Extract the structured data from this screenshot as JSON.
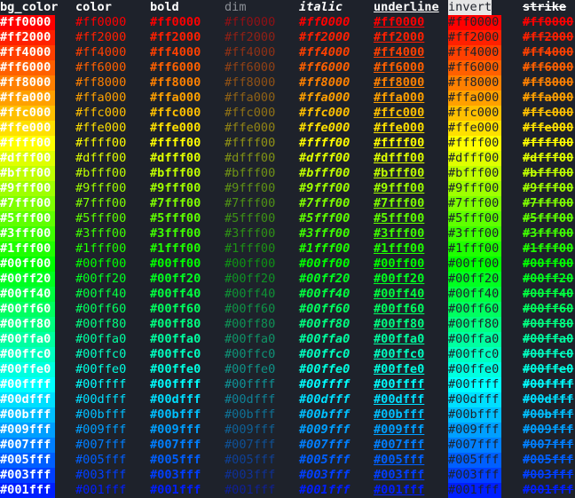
{
  "headers": {
    "bg_color": "bg_color",
    "color": "color",
    "bold": "bold",
    "dim": "dim",
    "italic": "italic",
    "underline": "underline",
    "invert": "invert",
    "strike": "strike"
  },
  "rows": [
    "#ff0000",
    "#ff2000",
    "#ff4000",
    "#ff6000",
    "#ff8000",
    "#ffa000",
    "#ffc000",
    "#ffe000",
    "#ffff00",
    "#dfff00",
    "#bfff00",
    "#9fff00",
    "#7fff00",
    "#5fff00",
    "#3fff00",
    "#1fff00",
    "#00ff00",
    "#00ff20",
    "#00ff40",
    "#00ff60",
    "#00ff80",
    "#00ffa0",
    "#00ffc0",
    "#00ffe0",
    "#00ffff",
    "#00dfff",
    "#00bfff",
    "#009fff",
    "#007fff",
    "#005fff",
    "#003fff",
    "#001fff"
  ],
  "colors": {
    "background": "#1e222b",
    "header_text": "#ffffff",
    "dim_header_text": "#8b8f96",
    "invert_header_bg": "#e6e6e6"
  }
}
